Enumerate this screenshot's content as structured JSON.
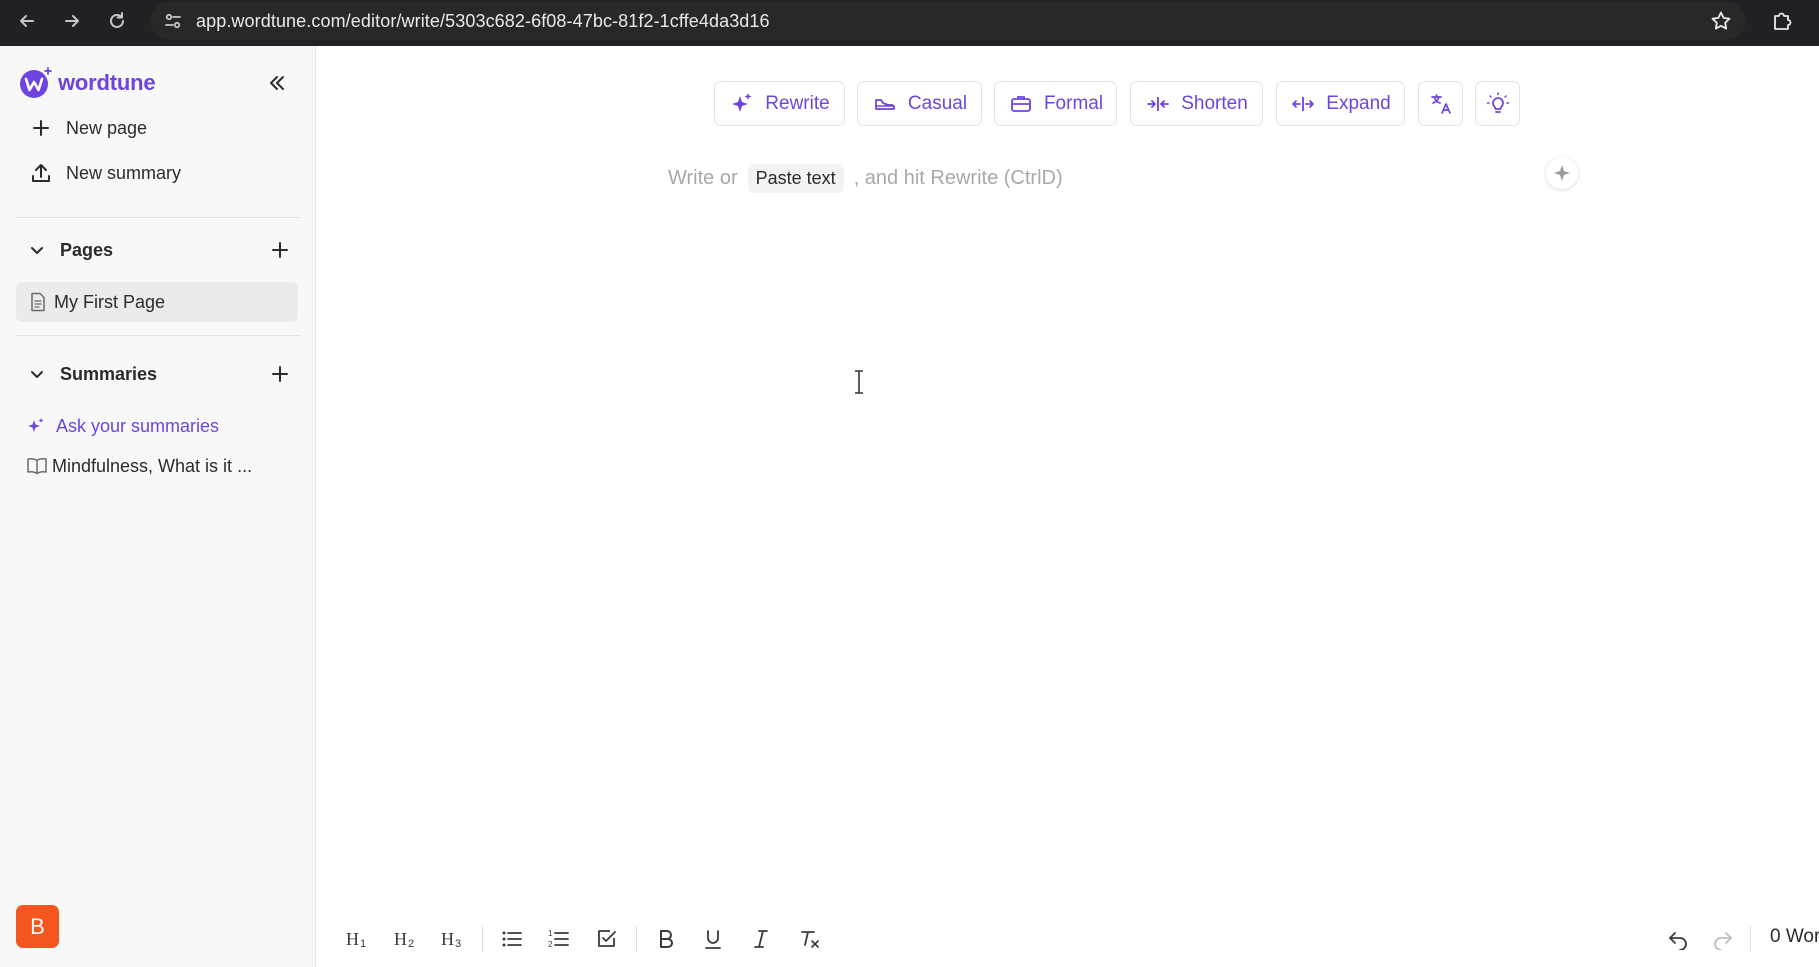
{
  "browser": {
    "url": "app.wordtune.com/editor/write/5303c682-6f08-47bc-81f2-1cffe4da3d16"
  },
  "sidebar": {
    "logo_text": "wordtune",
    "new_page": "New page",
    "new_summary": "New summary",
    "pages_section": {
      "title": "Pages",
      "items": [
        {
          "label": "My First Page"
        }
      ]
    },
    "summaries_section": {
      "title": "Summaries",
      "ask_link": "Ask your summaries",
      "items": [
        {
          "label": "Mindfulness, What is it ..."
        }
      ]
    },
    "avatar_initial": "B"
  },
  "toolbar": {
    "rewrite": "Rewrite",
    "casual": "Casual",
    "formal": "Formal",
    "shorten": "Shorten",
    "expand": "Expand"
  },
  "editor": {
    "hint_before": "Write or",
    "paste_label": "Paste text",
    "hint_after": ", and hit Rewrite (CtrlD)"
  },
  "format_bar": {
    "word_count": "0 Wor"
  },
  "colors": {
    "accent": "#6d44e0",
    "browser_bg": "#202124",
    "avatar_bg": "#f5561f",
    "sidebar_bg": "#f8f8f8"
  },
  "icons": {
    "toolbar": [
      "sparkles-icon",
      "casual-shoe-icon",
      "briefcase-icon",
      "shorten-arrows-icon",
      "expand-arrows-icon",
      "translate-icon",
      "lightbulb-icon"
    ],
    "format": [
      "heading1-icon",
      "heading2-icon",
      "heading3-icon",
      "bullet-list-icon",
      "numbered-list-icon",
      "checklist-icon",
      "bold-icon",
      "underline-icon",
      "italic-icon",
      "clear-format-icon",
      "undo-icon",
      "redo-icon"
    ]
  }
}
